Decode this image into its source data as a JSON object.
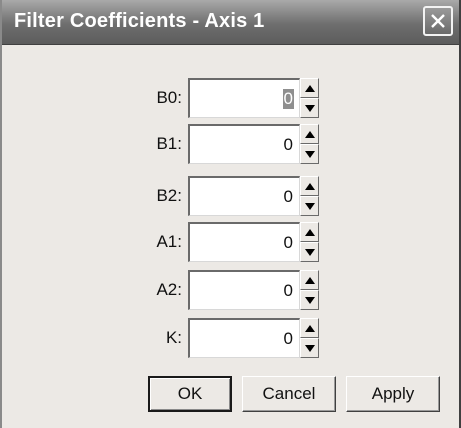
{
  "window": {
    "title": "Filter Coefficients - Axis 1"
  },
  "fields": [
    {
      "label": "B0:",
      "value": "0"
    },
    {
      "label": "B1:",
      "value": "0"
    },
    {
      "label": "B2:",
      "value": "0"
    },
    {
      "label": "A1:",
      "value": "0"
    },
    {
      "label": "A2:",
      "value": "0"
    },
    {
      "label": "K:",
      "value": "0"
    }
  ],
  "buttons": {
    "ok": "OK",
    "cancel": "Cancel",
    "apply": "Apply"
  },
  "icons": {
    "close": "close-icon",
    "spin_up": "up-arrow-icon",
    "spin_down": "down-arrow-icon"
  }
}
